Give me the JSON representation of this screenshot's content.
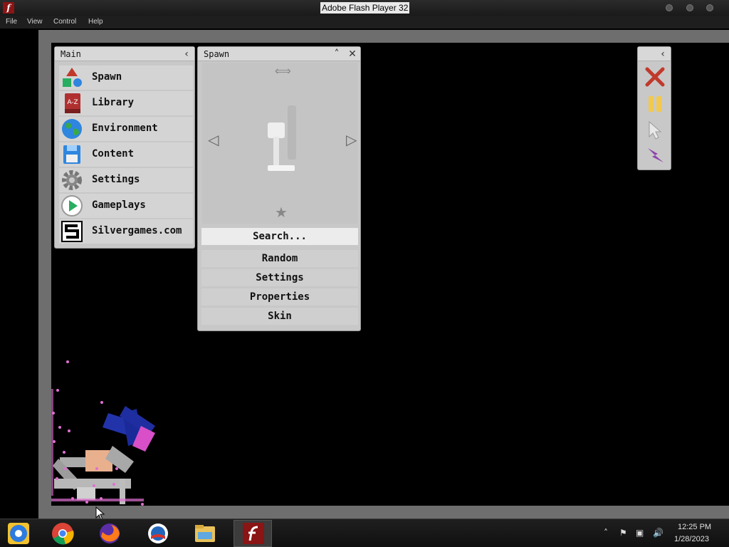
{
  "window": {
    "title": "Adobe Flash Player 32"
  },
  "menubar": {
    "items": [
      "File",
      "View",
      "Control",
      "Help"
    ]
  },
  "main_panel": {
    "title": "Main",
    "items": [
      {
        "label": "Spawn",
        "icon": "shapes-icon"
      },
      {
        "label": "Library",
        "icon": "book-icon"
      },
      {
        "label": "Environment",
        "icon": "globe-icon"
      },
      {
        "label": "Content",
        "icon": "floppy-icon"
      },
      {
        "label": "Settings",
        "icon": "gear-icon"
      },
      {
        "label": "Gameplays",
        "icon": "play-icon"
      },
      {
        "label": "Silvergames.com",
        "icon": "silvergames-logo-icon"
      }
    ]
  },
  "spawn_panel": {
    "title": "Spawn",
    "search": "Search...",
    "options": [
      "Random",
      "Settings",
      "Properties",
      "Skin"
    ]
  },
  "toolbar": {
    "items": [
      "clear-icon",
      "pause-icon",
      "cursor-icon",
      "lightning-icon"
    ]
  },
  "taskbar": {
    "apps": [
      "chromium-icon",
      "chrome-icon",
      "firefox-icon",
      "obama-campaign-icon",
      "file-explorer-icon",
      "flash-player-icon"
    ],
    "time": "12:25 PM",
    "date": "1/28/2023"
  },
  "colors": {
    "panel": "#c8c8c8",
    "stage": "#000000",
    "accent_red": "#c0392b",
    "accent_yellow": "#f2c94c",
    "accent_purple": "#8e44ad"
  }
}
